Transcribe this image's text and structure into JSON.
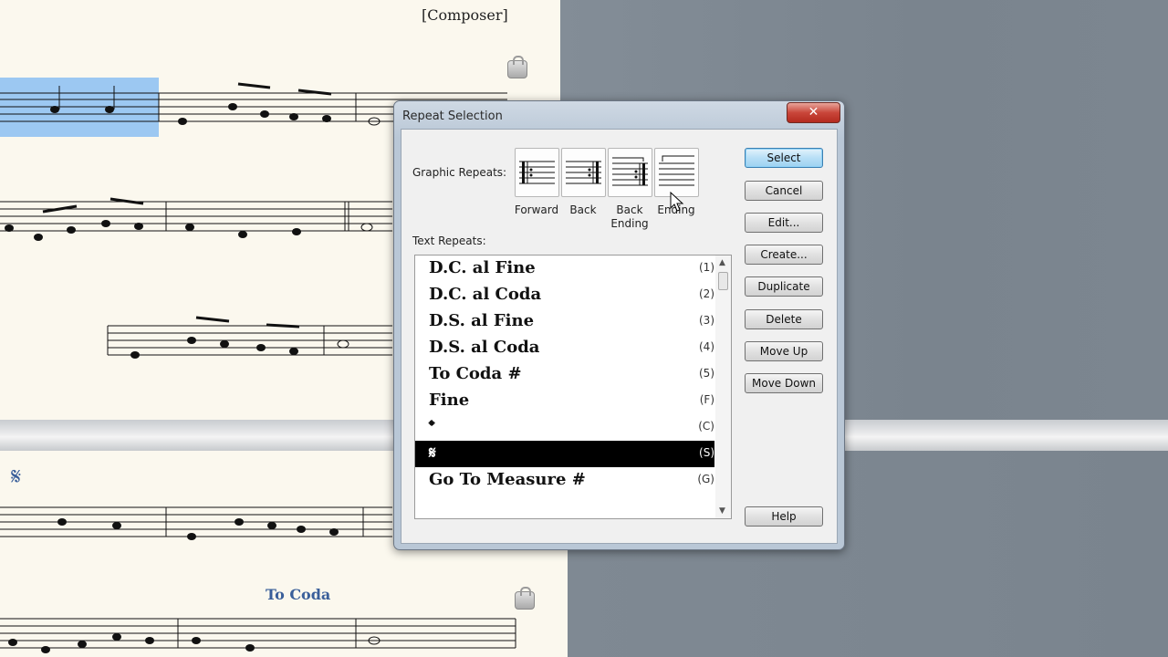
{
  "score": {
    "composer": "[Composer]",
    "segno_symbol": "𝄋",
    "to_coda_text": "To Coda",
    "highlight_color": "#9cc8f2",
    "marking_color": "#3a5f9a"
  },
  "dialog": {
    "title": "Repeat Selection",
    "close_symbol": "✕",
    "graphic_repeats_label": "Graphic Repeats:",
    "graphic_repeats": [
      {
        "label": "Forward",
        "icon": "forward-repeat-icon"
      },
      {
        "label": "Back",
        "icon": "back-repeat-icon"
      },
      {
        "label": "Back Ending",
        "label_line1": "Back",
        "label_line2": "Ending",
        "icon": "back-ending-icon"
      },
      {
        "label": "Ending",
        "icon": "ending-icon"
      }
    ],
    "text_repeats_label": "Text Repeats:",
    "text_repeats": [
      {
        "text": "D.C. al Fine",
        "key": "(1)"
      },
      {
        "text": "D.C. al Coda",
        "key": "(2)"
      },
      {
        "text": "D.S. al Fine",
        "key": "(3)"
      },
      {
        "text": "D.S. al Coda",
        "key": "(4)"
      },
      {
        "text": "To Coda #",
        "key": "(5)"
      },
      {
        "text": "Fine",
        "key": "(F)"
      },
      {
        "text": "𝄌",
        "key": "(C)",
        "icon": "coda-symbol-icon"
      },
      {
        "text": "𝄋",
        "key": "(S)",
        "icon": "segno-symbol-icon",
        "selected": true
      },
      {
        "text": "Go To Measure #",
        "key": "(G)"
      }
    ],
    "buttons": {
      "select": "Select",
      "cancel": "Cancel",
      "edit": "Edit...",
      "create": "Create...",
      "duplicate": "Duplicate",
      "delete": "Delete",
      "move_up": "Move Up",
      "move_down": "Move Down",
      "help": "Help"
    }
  }
}
